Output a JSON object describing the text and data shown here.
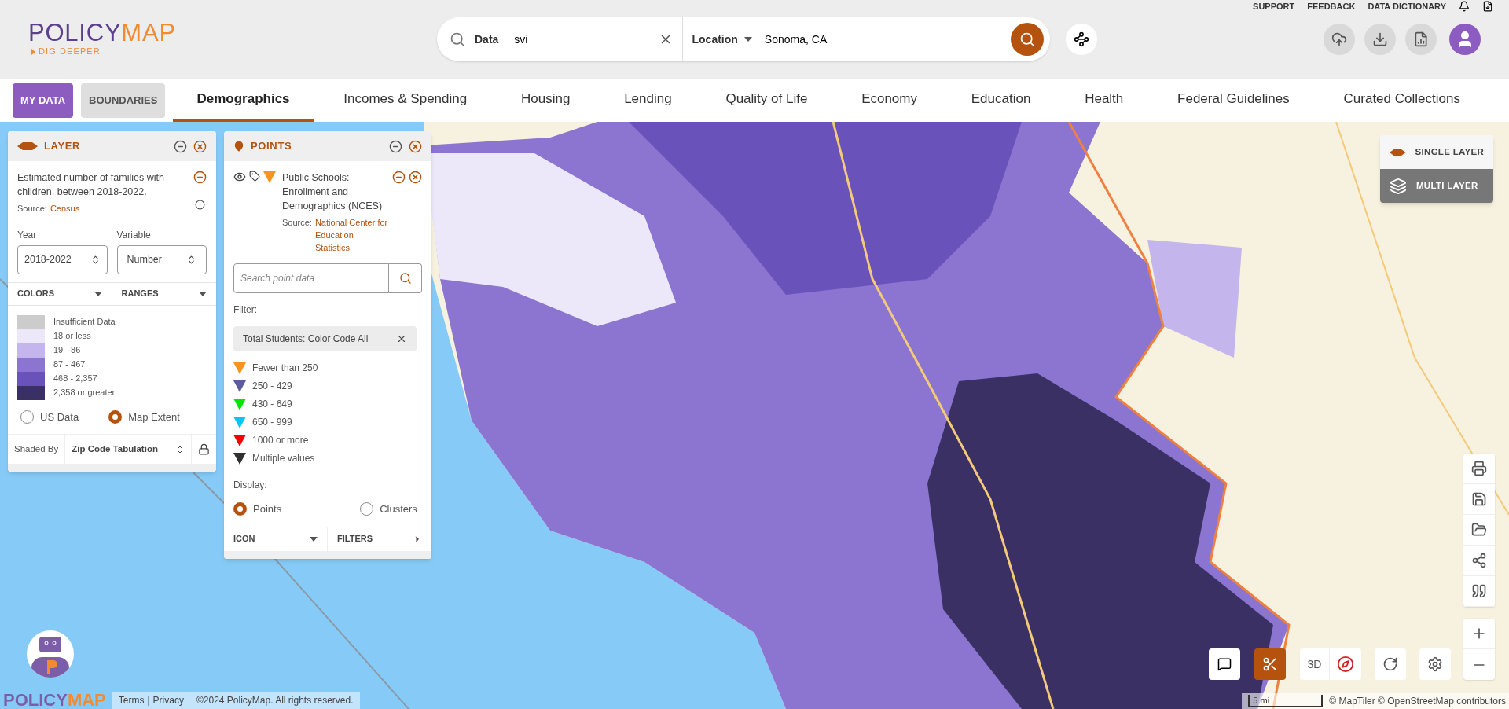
{
  "top_links": [
    "SUPPORT",
    "FEEDBACK",
    "DATA DICTIONARY"
  ],
  "logo": {
    "word_1": "POLICY",
    "word_2": "MAP",
    "tagline": "DIG DEEPER"
  },
  "search": {
    "data_label": "Data",
    "data_value": "svi",
    "location_label": "Location",
    "location_value": "Sonoma, CA"
  },
  "nav_buttons": [
    {
      "label": "MY DATA",
      "selected": true
    },
    {
      "label": "BOUNDARIES",
      "selected": false
    }
  ],
  "tabs": [
    {
      "label": "Demographics",
      "selected": true
    },
    {
      "label": "Incomes & Spending",
      "selected": false
    },
    {
      "label": "Housing",
      "selected": false
    },
    {
      "label": "Lending",
      "selected": false
    },
    {
      "label": "Quality of Life",
      "selected": false
    },
    {
      "label": "Economy",
      "selected": false
    },
    {
      "label": "Education",
      "selected": false
    },
    {
      "label": "Health",
      "selected": false
    },
    {
      "label": "Federal Guidelines",
      "selected": false
    },
    {
      "label": "Curated Collections",
      "selected": false
    }
  ],
  "layer_panel": {
    "title": "LAYER",
    "description": "Estimated number of families with children, between 2018-2022.",
    "source_label": "Source:",
    "source_link": "Census",
    "year_label": "Year",
    "year_value": "2018-2022",
    "variable_label": "Variable",
    "variable_value": "Number",
    "menus": [
      "COLORS",
      "RANGES"
    ],
    "legend": [
      {
        "label": "Insufficient Data",
        "color": "#cccccc"
      },
      {
        "label": "18 or less",
        "color": "#ece8fa"
      },
      {
        "label": "19 - 86",
        "color": "#c4b6ec"
      },
      {
        "label": "87 - 467",
        "color": "#8b75d0"
      },
      {
        "label": "468 - 2,357",
        "color": "#6a52bb"
      },
      {
        "label": "2,358 or greater",
        "color": "#3b3064"
      }
    ],
    "extent_options": [
      {
        "label": "US Data",
        "selected": false
      },
      {
        "label": "Map Extent",
        "selected": true
      }
    ],
    "shaded_by_label": "Shaded By",
    "shaded_by_value": "Zip Code Tabulation"
  },
  "points_panel": {
    "title": "POINTS",
    "dataset": "Public Schools: Enrollment and Demographics (NCES)",
    "source_label": "Source:",
    "source_link": "National Center for Education Statistics",
    "search_placeholder": "Search point data",
    "filter_label": "Filter:",
    "filter_chip": "Total Students: Color Code All",
    "legend": [
      {
        "label": "Fewer than 250",
        "color": "#f7941d"
      },
      {
        "label": "250 - 429",
        "color": "#5c5c9e"
      },
      {
        "label": "430 - 649",
        "color": "#00e600"
      },
      {
        "label": "650 - 999",
        "color": "#00c8f5"
      },
      {
        "label": "1000 or more",
        "color": "#f50000"
      },
      {
        "label": "Multiple values",
        "color": "#303030"
      }
    ],
    "display_label": "Display:",
    "display_options": [
      {
        "label": "Points",
        "selected": true
      },
      {
        "label": "Clusters",
        "selected": false
      }
    ],
    "menus": [
      "ICON",
      "FILTERS"
    ]
  },
  "layer_modes": [
    {
      "label": "SINGLE LAYER",
      "selected": true
    },
    {
      "label": "MULTI LAYER",
      "selected": false
    }
  ],
  "map_tools": {
    "three_d": "3D",
    "scissors_on": true
  },
  "scale": "5 mi",
  "attribution": "© MapTiler © OpenStreetMap contributors",
  "footer": {
    "logo_word_1": "POLICY",
    "logo_word_2": "MAP",
    "terms": "Terms",
    "separator": "|",
    "privacy": "Privacy",
    "copyright": "©2024 PolicyMap. All rights reserved."
  }
}
